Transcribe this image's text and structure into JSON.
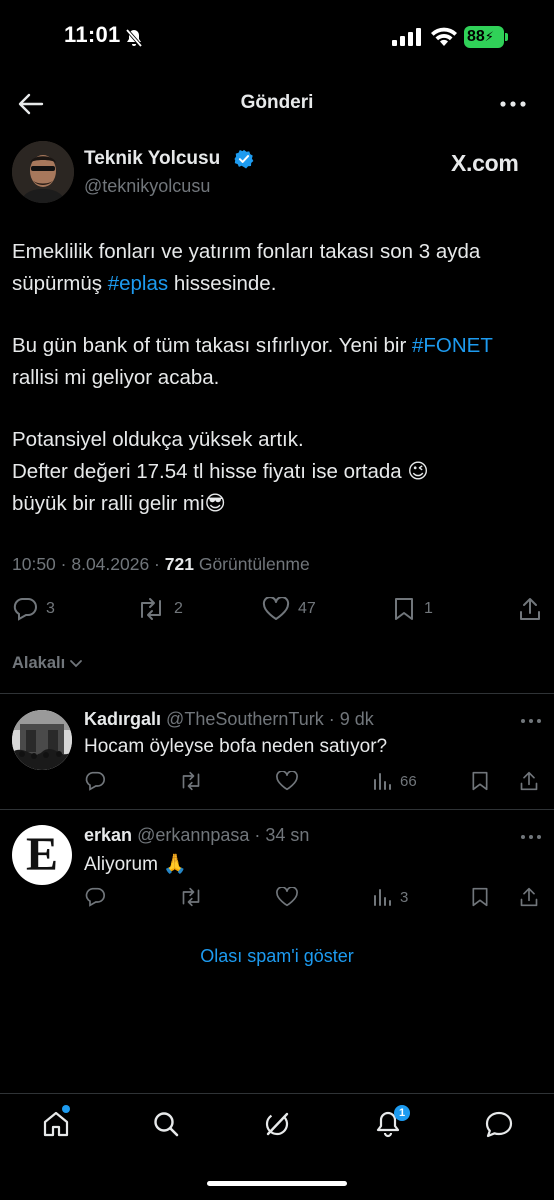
{
  "status_bar": {
    "time": "11:01",
    "battery": "88"
  },
  "header": {
    "title": "Gönderi"
  },
  "post": {
    "author_name": "Teknik Yolcusu",
    "author_handle": "@teknikyolcusu",
    "source": "X.com",
    "paragraph1_a": "Emeklilik fonları ve yatırım fonları takası son 3 ayda süpürmüş ",
    "paragraph1_tag": "#eplas",
    "paragraph1_b": " hissesinde.",
    "paragraph2_a": "Bu gün bank of tüm takası sıfırlıyor. Yeni bir ",
    "paragraph2_tag": "#FONET",
    "paragraph2_b": " rallisi mi geliyor acaba.",
    "paragraph3_line1": "Potansiyel oldukça yüksek artık.",
    "paragraph3_line2": "Defter değeri 17.54 tl hisse fiyatı ise ortada 😉",
    "paragraph3_line3": "büyük bir ralli gelir mi😎",
    "timestamp": "10:50 · 8.04.2026 · ",
    "views_count": "721",
    "views_label": "Görüntülenme",
    "replies": "3",
    "reposts": "2",
    "likes": "47",
    "bookmarks": "1"
  },
  "sort_label": "Alakalı",
  "replies": [
    {
      "name": "Kadırgalı",
      "handle_time": "@TheSouthernTurk · 9 dk",
      "text": "Hocam öyleyse bofa neden satıyor?",
      "views": "66"
    },
    {
      "name": "erkan",
      "handle_time": "@erkannpasa · 34 sn",
      "text": "Aliyorum 🙏",
      "views": "3",
      "avatar_letter": "E"
    }
  ],
  "spam_link": "Olası spam'i göster",
  "nav": {
    "notifications_badge": "1"
  },
  "colors": {
    "accent": "#1d9bf0",
    "background": "#000000",
    "battery": "#30d158"
  }
}
